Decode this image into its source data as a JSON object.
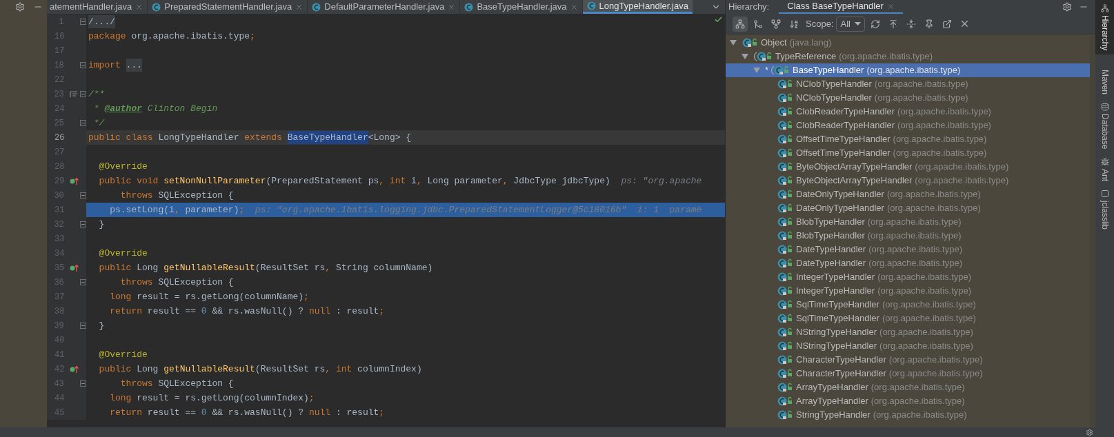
{
  "editor_tabs": [
    {
      "label": "atementHandler.java",
      "selected": false
    },
    {
      "label": "PreparedStatementHandler.java",
      "selected": false
    },
    {
      "label": "DefaultParameterHandler.java",
      "selected": false
    },
    {
      "label": "BaseTypeHandler.java",
      "selected": false
    },
    {
      "label": "LongTypeHandler.java",
      "selected": true
    }
  ],
  "code_lines": [
    {
      "number": "1",
      "fold": true,
      "current": false,
      "execution": false,
      "tokens": [
        {
          "kind": "folded",
          "text": "/.../"
        }
      ]
    },
    {
      "number": "16",
      "fold": false,
      "current": false,
      "execution": false,
      "tokens": [
        {
          "kind": "kw",
          "text": "package"
        },
        {
          "kind": "plain",
          "text": " org.apache.ibatis.type"
        },
        {
          "kind": "kw",
          "text": ";"
        }
      ]
    },
    {
      "number": "17",
      "fold": false,
      "current": false,
      "execution": false
    },
    {
      "number": "18",
      "fold": true,
      "current": false,
      "execution": false,
      "tokens": [
        {
          "kind": "kw",
          "text": "import "
        },
        {
          "kind": "folded",
          "text": "..."
        }
      ]
    },
    {
      "number": "22",
      "fold": false,
      "current": false,
      "execution": false
    },
    {
      "number": "23",
      "fold": true,
      "current": false,
      "execution": false,
      "gutter_icon": {
        "kind": "doc"
      },
      "tokens": [
        {
          "kind": "comment",
          "text": "/**"
        }
      ]
    },
    {
      "number": "24",
      "fold": false,
      "current": false,
      "execution": false,
      "tokens": [
        {
          "kind": "comment",
          "text": " * "
        },
        {
          "kind": "doctag",
          "text": "@author"
        },
        {
          "kind": "comment",
          "text": " Clinton Begin"
        }
      ]
    },
    {
      "number": "25",
      "fold": true,
      "current": false,
      "execution": false,
      "tokens": [
        {
          "kind": "comment",
          "text": " */"
        }
      ]
    },
    {
      "number": "26",
      "fold": false,
      "current": true,
      "execution": false,
      "tokens": [
        {
          "kind": "kw",
          "text": "public class "
        },
        {
          "kind": "plain",
          "text": "LongTypeHandler "
        },
        {
          "kind": "kw",
          "text": "extends "
        },
        {
          "kind": "match",
          "text": "BaseTypeHandler"
        },
        {
          "kind": "plain",
          "text": "<Long> {"
        }
      ]
    },
    {
      "number": "27",
      "fold": false,
      "current": false,
      "execution": false
    },
    {
      "number": "28",
      "fold": false,
      "current": false,
      "execution": false,
      "tokens": [
        {
          "kind": "ann",
          "text": "  @Override"
        }
      ]
    },
    {
      "number": "29",
      "fold": false,
      "current": false,
      "execution": false,
      "gutter_icon": {
        "kind": "override"
      },
      "tokens": [
        {
          "kind": "kw",
          "text": "  public void "
        },
        {
          "kind": "method",
          "text": "setNonNullParameter"
        },
        {
          "kind": "plain",
          "text": "(PreparedStatement ps"
        },
        {
          "kind": "kw",
          "text": ", int "
        },
        {
          "kind": "plain",
          "text": "i"
        },
        {
          "kind": "kw",
          "text": ", "
        },
        {
          "kind": "plain",
          "text": "Long parameter"
        },
        {
          "kind": "kw",
          "text": ", "
        },
        {
          "kind": "plain",
          "text": "JdbcType jdbcType)"
        },
        {
          "kind": "hint",
          "text": "  ps: \"org.apache"
        }
      ]
    },
    {
      "number": "30",
      "fold": true,
      "current": false,
      "execution": false,
      "tokens": [
        {
          "kind": "kw",
          "text": "      throws "
        },
        {
          "kind": "plain",
          "text": "SQLException {"
        }
      ]
    },
    {
      "number": "31",
      "fold": false,
      "current": false,
      "execution": true,
      "tokens": [
        {
          "kind": "plain",
          "text": "    ps.setLong(i"
        },
        {
          "kind": "kw",
          "text": ", "
        },
        {
          "kind": "plain",
          "text": "parameter)"
        },
        {
          "kind": "kw",
          "text": ";"
        },
        {
          "kind": "hint",
          "text": "  ps: \"org.apache.ibatis.logging.jdbc.PreparedStatementLogger@5c18016b\"  i: 1  parame"
        }
      ]
    },
    {
      "number": "32",
      "fold": true,
      "current": false,
      "execution": false,
      "tokens": [
        {
          "kind": "plain",
          "text": "  }"
        }
      ]
    },
    {
      "number": "33",
      "fold": false,
      "current": false,
      "execution": false
    },
    {
      "number": "34",
      "fold": false,
      "current": false,
      "execution": false,
      "tokens": [
        {
          "kind": "ann",
          "text": "  @Override"
        }
      ]
    },
    {
      "number": "35",
      "fold": false,
      "current": false,
      "execution": false,
      "gutter_icon": {
        "kind": "override"
      },
      "tokens": [
        {
          "kind": "kw",
          "text": "  public "
        },
        {
          "kind": "plain",
          "text": "Long "
        },
        {
          "kind": "method",
          "text": "getNullableResult"
        },
        {
          "kind": "plain",
          "text": "(ResultSet rs"
        },
        {
          "kind": "kw",
          "text": ", "
        },
        {
          "kind": "plain",
          "text": "String columnName)"
        }
      ]
    },
    {
      "number": "36",
      "fold": true,
      "current": false,
      "execution": false,
      "tokens": [
        {
          "kind": "kw",
          "text": "      throws "
        },
        {
          "kind": "plain",
          "text": "SQLException {"
        }
      ]
    },
    {
      "number": "37",
      "fold": false,
      "current": false,
      "execution": false,
      "tokens": [
        {
          "kind": "kw",
          "text": "    long "
        },
        {
          "kind": "plain",
          "text": "result = rs.getLong(columnName)"
        },
        {
          "kind": "kw",
          "text": ";"
        }
      ]
    },
    {
      "number": "38",
      "fold": false,
      "current": false,
      "execution": false,
      "tokens": [
        {
          "kind": "kw",
          "text": "    return "
        },
        {
          "kind": "plain",
          "text": "result == "
        },
        {
          "kind": "num",
          "text": "0"
        },
        {
          "kind": "plain",
          "text": " && rs.wasNull() ? "
        },
        {
          "kind": "kw",
          "text": "null "
        },
        {
          "kind": "plain",
          "text": ": result"
        },
        {
          "kind": "kw",
          "text": ";"
        }
      ]
    },
    {
      "number": "39",
      "fold": true,
      "current": false,
      "execution": false,
      "tokens": [
        {
          "kind": "plain",
          "text": "  }"
        }
      ]
    },
    {
      "number": "40",
      "fold": false,
      "current": false,
      "execution": false
    },
    {
      "number": "41",
      "fold": false,
      "current": false,
      "execution": false,
      "tokens": [
        {
          "kind": "ann",
          "text": "  @Override"
        }
      ]
    },
    {
      "number": "42",
      "fold": false,
      "current": false,
      "execution": false,
      "gutter_icon": {
        "kind": "override"
      },
      "tokens": [
        {
          "kind": "kw",
          "text": "  public "
        },
        {
          "kind": "plain",
          "text": "Long "
        },
        {
          "kind": "method",
          "text": "getNullableResult"
        },
        {
          "kind": "plain",
          "text": "(ResultSet rs"
        },
        {
          "kind": "kw",
          "text": ", int "
        },
        {
          "kind": "plain",
          "text": "columnIndex)"
        }
      ]
    },
    {
      "number": "43",
      "fold": true,
      "current": false,
      "execution": false,
      "tokens": [
        {
          "kind": "kw",
          "text": "      throws "
        },
        {
          "kind": "plain",
          "text": "SQLException {"
        }
      ]
    },
    {
      "number": "44",
      "fold": false,
      "current": false,
      "execution": false,
      "tokens": [
        {
          "kind": "kw",
          "text": "    long "
        },
        {
          "kind": "plain",
          "text": "result = rs.getLong(columnIndex)"
        },
        {
          "kind": "kw",
          "text": ";"
        }
      ]
    },
    {
      "number": "45",
      "fold": false,
      "current": false,
      "execution": false,
      "tokens": [
        {
          "kind": "kw",
          "text": "    return "
        },
        {
          "kind": "plain",
          "text": "result == "
        },
        {
          "kind": "num",
          "text": "0"
        },
        {
          "kind": "plain",
          "text": " && rs.wasNull() ? "
        },
        {
          "kind": "kw",
          "text": "null "
        },
        {
          "kind": "plain",
          "text": ": result"
        },
        {
          "kind": "kw",
          "text": ";"
        }
      ]
    }
  ],
  "hierarchy": {
    "title": "Hierarchy:",
    "tab": {
      "label": "Class BaseTypeHandler",
      "selected": true
    },
    "scope": {
      "label": "Scope:",
      "value": "All"
    },
    "tree": [
      {
        "name": "Object",
        "package": "(java.lang)",
        "abstract": false,
        "expanded": true,
        "selected": false,
        "children": [
          {
            "name": "TypeReference",
            "package": "(org.apache.ibatis.type)",
            "abstract": true,
            "expanded": true,
            "selected": false,
            "children": [
              {
                "name": "BaseTypeHandler",
                "package": "(org.apache.ibatis.type)",
                "marker": "*",
                "abstract": true,
                "expanded": true,
                "selected": true,
                "children": [
                  {
                    "name": "NClobTypeHandler",
                    "package": "(org.apache.ibatis.type)",
                    "abstract": false,
                    "selected": false
                  },
                  {
                    "name": "NClobTypeHandler",
                    "package": "(org.apache.ibatis.type)",
                    "abstract": false,
                    "selected": false
                  },
                  {
                    "name": "ClobReaderTypeHandler",
                    "package": "(org.apache.ibatis.type)",
                    "abstract": false,
                    "selected": false
                  },
                  {
                    "name": "ClobReaderTypeHandler",
                    "package": "(org.apache.ibatis.type)",
                    "abstract": false,
                    "selected": false
                  },
                  {
                    "name": "OffsetTimeTypeHandler",
                    "package": "(org.apache.ibatis.type)",
                    "abstract": false,
                    "selected": false
                  },
                  {
                    "name": "OffsetTimeTypeHandler",
                    "package": "(org.apache.ibatis.type)",
                    "abstract": false,
                    "selected": false
                  },
                  {
                    "name": "ByteObjectArrayTypeHandler",
                    "package": "(org.apache.ibatis.type)",
                    "abstract": false,
                    "selected": false
                  },
                  {
                    "name": "ByteObjectArrayTypeHandler",
                    "package": "(org.apache.ibatis.type)",
                    "abstract": false,
                    "selected": false
                  },
                  {
                    "name": "DateOnlyTypeHandler",
                    "package": "(org.apache.ibatis.type)",
                    "abstract": false,
                    "selected": false
                  },
                  {
                    "name": "DateOnlyTypeHandler",
                    "package": "(org.apache.ibatis.type)",
                    "abstract": false,
                    "selected": false
                  },
                  {
                    "name": "BlobTypeHandler",
                    "package": "(org.apache.ibatis.type)",
                    "abstract": false,
                    "selected": false
                  },
                  {
                    "name": "BlobTypeHandler",
                    "package": "(org.apache.ibatis.type)",
                    "abstract": false,
                    "selected": false
                  },
                  {
                    "name": "DateTypeHandler",
                    "package": "(org.apache.ibatis.type)",
                    "abstract": false,
                    "selected": false
                  },
                  {
                    "name": "DateTypeHandler",
                    "package": "(org.apache.ibatis.type)",
                    "abstract": false,
                    "selected": false
                  },
                  {
                    "name": "IntegerTypeHandler",
                    "package": "(org.apache.ibatis.type)",
                    "abstract": false,
                    "selected": false
                  },
                  {
                    "name": "IntegerTypeHandler",
                    "package": "(org.apache.ibatis.type)",
                    "abstract": false,
                    "selected": false
                  },
                  {
                    "name": "SqlTimeTypeHandler",
                    "package": "(org.apache.ibatis.type)",
                    "abstract": false,
                    "selected": false
                  },
                  {
                    "name": "SqlTimeTypeHandler",
                    "package": "(org.apache.ibatis.type)",
                    "abstract": false,
                    "selected": false
                  },
                  {
                    "name": "NStringTypeHandler",
                    "package": "(org.apache.ibatis.type)",
                    "abstract": false,
                    "selected": false
                  },
                  {
                    "name": "NStringTypeHandler",
                    "package": "(org.apache.ibatis.type)",
                    "abstract": false,
                    "selected": false
                  },
                  {
                    "name": "CharacterTypeHandler",
                    "package": "(org.apache.ibatis.type)",
                    "abstract": false,
                    "selected": false
                  },
                  {
                    "name": "CharacterTypeHandler",
                    "package": "(org.apache.ibatis.type)",
                    "abstract": false,
                    "selected": false
                  },
                  {
                    "name": "ArrayTypeHandler",
                    "package": "(org.apache.ibatis.type)",
                    "abstract": false,
                    "selected": false
                  },
                  {
                    "name": "ArrayTypeHandler",
                    "package": "(org.apache.ibatis.type)",
                    "abstract": false,
                    "selected": false
                  },
                  {
                    "name": "StringTypeHandler",
                    "package": "(org.apache.ibatis.type)",
                    "abstract": false,
                    "selected": false
                  }
                ]
              }
            ]
          }
        ]
      }
    ]
  },
  "side_tools": [
    {
      "label": "Hierarchy",
      "selected": true
    },
    {
      "label": "Maven",
      "selected": false
    },
    {
      "label": "Database",
      "selected": false
    },
    {
      "label": "Ant",
      "selected": false
    },
    {
      "label": "jclasslib",
      "selected": false
    }
  ]
}
